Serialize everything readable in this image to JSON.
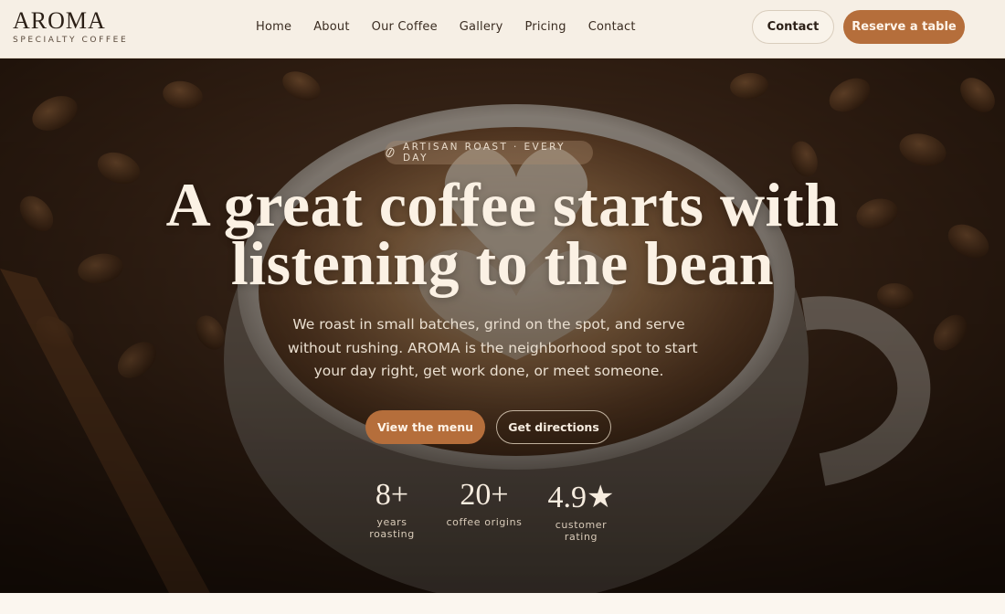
{
  "brand": {
    "name": "AROMA",
    "tagline": "SPECIALTY COFFEE"
  },
  "nav": {
    "items": [
      "Home",
      "About",
      "Our Coffee",
      "Gallery",
      "Pricing",
      "Contact"
    ]
  },
  "header_actions": {
    "contact_label": "Contact",
    "reserve_label": "Reserve a table"
  },
  "hero": {
    "eyebrow": "ARTISAN ROAST · EVERY DAY",
    "eyebrow_icon": "coffee-bean-icon",
    "headline_lines": [
      "A great coffee starts with",
      "listening to the bean"
    ],
    "lede_lines": [
      "We roast in small batches, grind on the spot, and serve",
      "without rushing. AROMA is the neighborhood spot to start",
      "your day right, get work done, or meet someone."
    ],
    "cta_primary": "View the menu",
    "cta_secondary": "Get directions",
    "stats": [
      {
        "value": "8+",
        "label": "years roasting"
      },
      {
        "value": "20+",
        "label": "coffee origins"
      },
      {
        "value": "4.9★",
        "label": "customer rating"
      }
    ]
  },
  "colors": {
    "accent": "#b56e3b",
    "header_bg": "#f6efe5",
    "hero_text": "#fbf1e4",
    "page_bg": "#fbf6ef"
  }
}
